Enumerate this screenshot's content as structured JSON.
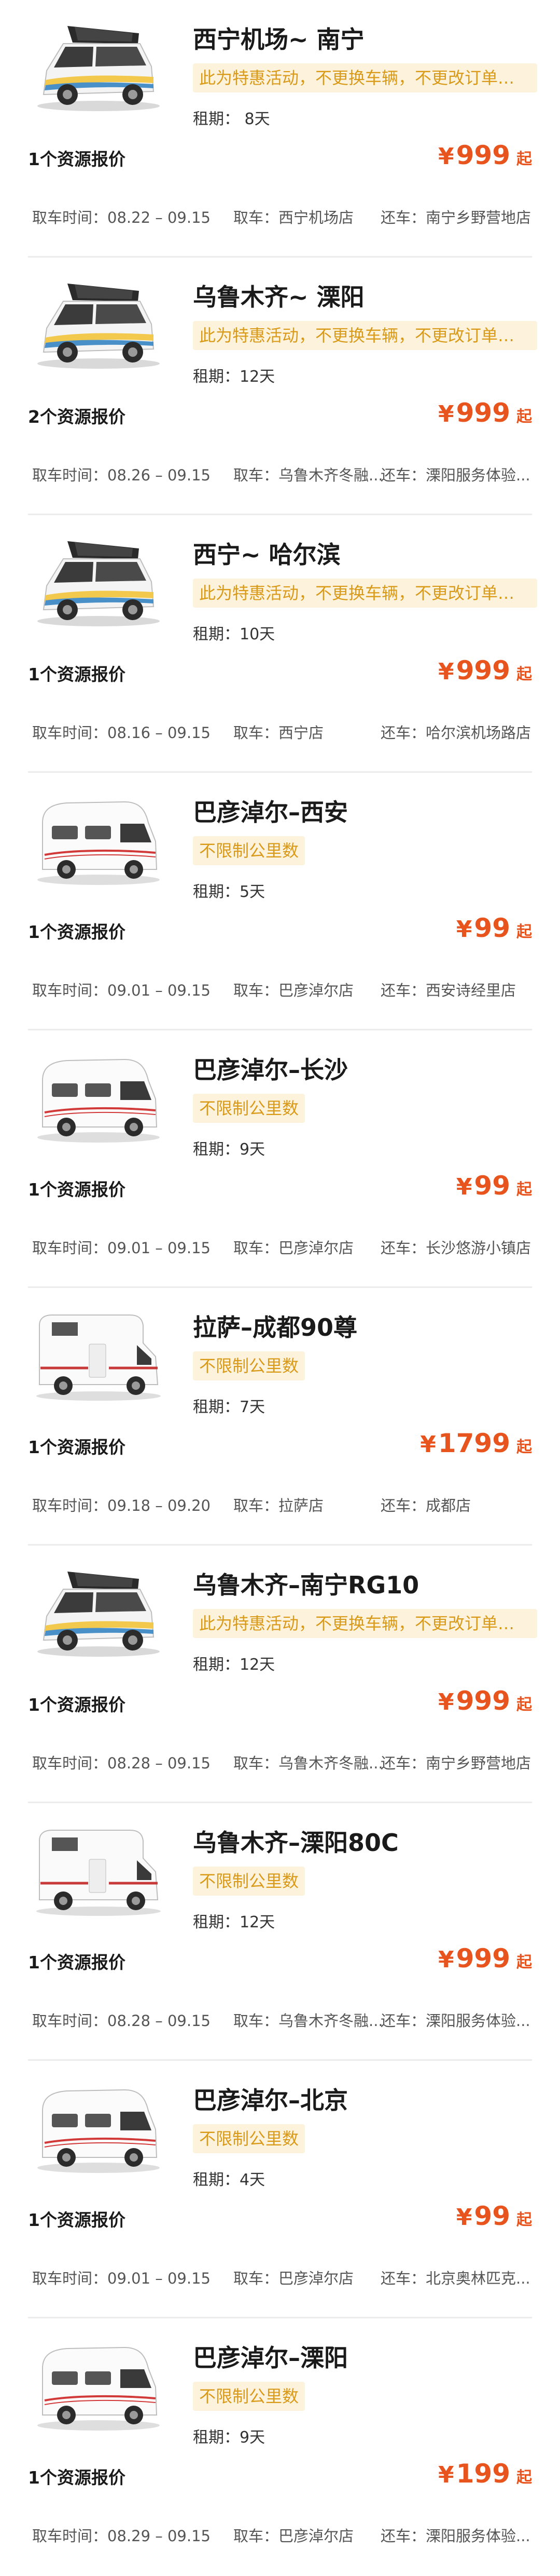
{
  "listings": [
    {
      "title": "西宁机场~ 南宁",
      "tag": "此为特惠活动，不更换车辆，不更改订单时间...",
      "duration": "租期： 8天",
      "offers": "1个资源报价",
      "price_symbol": "¥",
      "price": "999",
      "price_suffix": "起",
      "pickup_time": "取车时间：08.22 – 09.15",
      "pickup_store": "取车：西宁机场店",
      "return_store": "还车：南宁乡野营地店",
      "vehicle": "van"
    },
    {
      "title": "乌鲁木齐~ 溧阳",
      "tag": "此为特惠活动，不更换车辆，不更改订单时间...",
      "duration": "租期：12天",
      "offers": "2个资源报价",
      "price_symbol": "¥",
      "price": "999",
      "price_suffix": "起",
      "pickup_time": "取车时间：08.26 – 09.15",
      "pickup_store": "取车：乌鲁木齐冬融...",
      "return_store": "还车：溧阳服务体验...",
      "vehicle": "van"
    },
    {
      "title": "西宁~ 哈尔滨",
      "tag": "此为特惠活动，不更换车辆，不更改订单时间...",
      "duration": "租期：10天",
      "offers": "1个资源报价",
      "price_symbol": "¥",
      "price": "999",
      "price_suffix": "起",
      "pickup_time": "取车时间：08.16 – 09.15",
      "pickup_store": "取车：西宁店",
      "return_store": "还车：哈尔滨机场路店",
      "vehicle": "van"
    },
    {
      "title": "巴彦淖尔–西安",
      "tag": "不限制公里数",
      "duration": "租期：5天",
      "offers": "1个资源报价",
      "price_symbol": "¥",
      "price": "99",
      "price_suffix": "起",
      "pickup_time": "取车时间：09.01 – 09.15",
      "pickup_store": "取车：巴彦淖尔店",
      "return_store": "还车：西安诗经里店",
      "vehicle": "hightop"
    },
    {
      "title": "巴彦淖尔–长沙",
      "tag": "不限制公里数",
      "duration": "租期：9天",
      "offers": "1个资源报价",
      "price_symbol": "¥",
      "price": "99",
      "price_suffix": "起",
      "pickup_time": "取车时间：09.01 – 09.15",
      "pickup_store": "取车：巴彦淖尔店",
      "return_store": "还车：长沙悠游小镇店",
      "vehicle": "hightop"
    },
    {
      "title": "拉萨–成都90尊",
      "tag": "不限制公里数",
      "duration": "租期：7天",
      "offers": "1个资源报价",
      "price_symbol": "¥",
      "price": "1799",
      "price_suffix": "起",
      "pickup_time": "取车时间：09.18 – 09.20",
      "pickup_store": "取车：拉萨店",
      "return_store": "还车：成都店",
      "vehicle": "motorhome"
    },
    {
      "title": "乌鲁木齐–南宁RG10",
      "tag": "此为特惠活动，不更换车辆，不更改订单时间...",
      "duration": "租期：12天",
      "offers": "1个资源报价",
      "price_symbol": "¥",
      "price": "999",
      "price_suffix": "起",
      "pickup_time": "取车时间：08.28 – 09.15",
      "pickup_store": "取车：乌鲁木齐冬融...",
      "return_store": "还车：南宁乡野营地店",
      "vehicle": "van"
    },
    {
      "title": "乌鲁木齐–溧阳80C",
      "tag": "不限制公里数",
      "duration": "租期：12天",
      "offers": "1个资源报价",
      "price_symbol": "¥",
      "price": "999",
      "price_suffix": "起",
      "pickup_time": "取车时间：08.28 – 09.15",
      "pickup_store": "取车：乌鲁木齐冬融...",
      "return_store": "还车：溧阳服务体验...",
      "vehicle": "motorhome"
    },
    {
      "title": "巴彦淖尔–北京",
      "tag": "不限制公里数",
      "duration": "租期：4天",
      "offers": "1个资源报价",
      "price_symbol": "¥",
      "price": "99",
      "price_suffix": "起",
      "pickup_time": "取车时间：09.01 – 09.15",
      "pickup_store": "取车：巴彦淖尔店",
      "return_store": "还车：北京奥林匹克...",
      "vehicle": "hightop"
    },
    {
      "title": "巴彦淖尔–溧阳",
      "tag": "不限制公里数",
      "duration": "租期：9天",
      "offers": "1个资源报价",
      "price_symbol": "¥",
      "price": "199",
      "price_suffix": "起",
      "pickup_time": "取车时间：08.29 – 09.15",
      "pickup_store": "取车：巴彦淖尔店",
      "return_store": "还车：溧阳服务体验...",
      "vehicle": "hightop"
    }
  ],
  "colors": {
    "price": "#e8541e",
    "tag_bg": "#fdf3dd",
    "tag_text": "#d99a1a"
  }
}
